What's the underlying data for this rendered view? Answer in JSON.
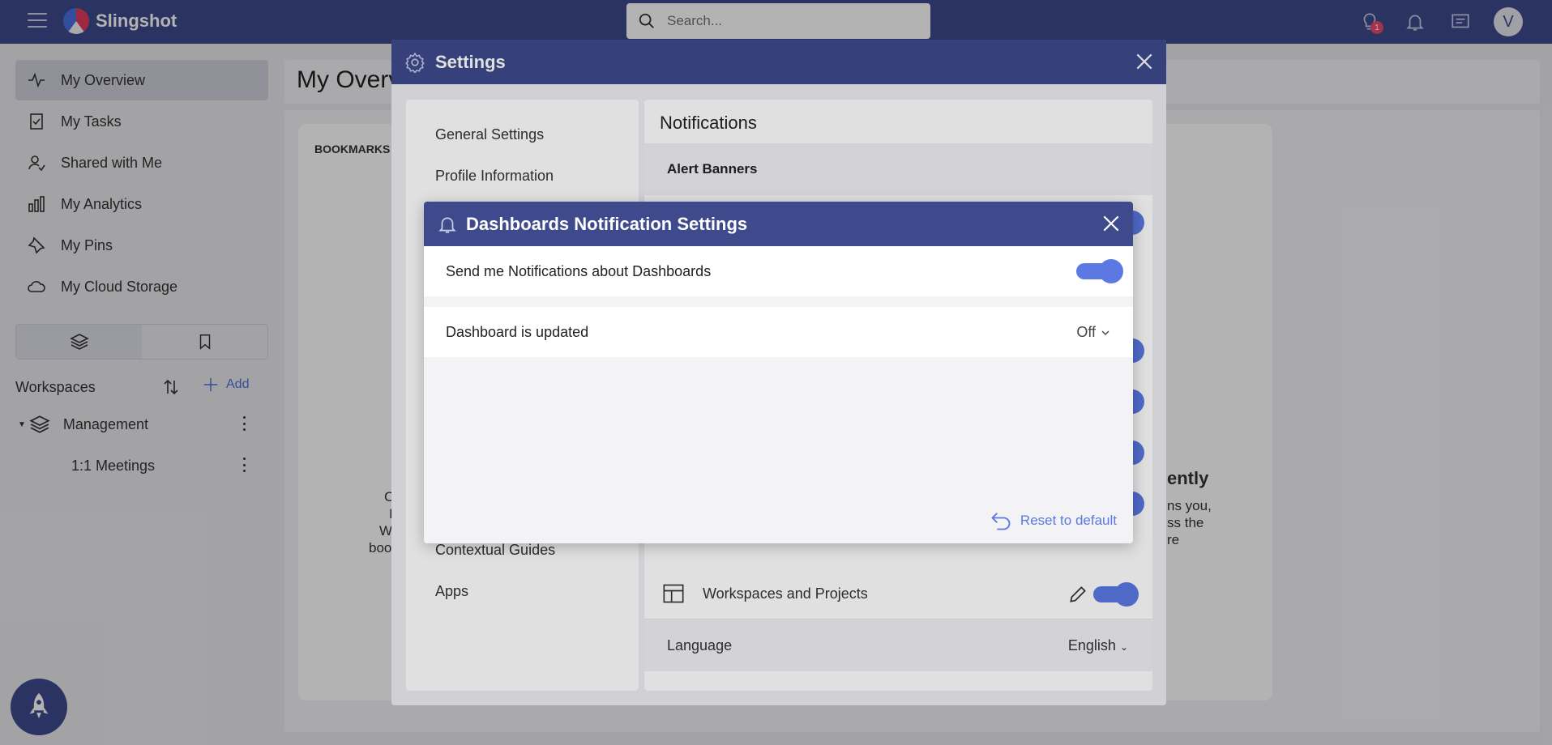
{
  "app": {
    "name": "Slingshot"
  },
  "search": {
    "placeholder": "Search..."
  },
  "topbar": {
    "notification_badge": "1",
    "avatar_initial": "V"
  },
  "sidebar": {
    "items": [
      {
        "label": "My Overview",
        "active": true
      },
      {
        "label": "My Tasks"
      },
      {
        "label": "Shared with Me"
      },
      {
        "label": "My Analytics"
      },
      {
        "label": "My Pins"
      },
      {
        "label": "My Cloud Storage"
      }
    ],
    "workspaces_label": "Workspaces",
    "add_label": "Add",
    "tree": [
      {
        "label": "Management"
      },
      {
        "label": "1:1 Meetings"
      }
    ]
  },
  "main": {
    "title": "My Overview",
    "bookmarks_title": "BOOKMARKS",
    "fragments_left": [
      "C",
      "I",
      "W",
      "boo"
    ],
    "fragments_right_title": "ently",
    "fragments_right": [
      "ns you,",
      "ss the",
      "re"
    ]
  },
  "settings": {
    "title": "Settings",
    "menu": [
      {
        "label": "General Settings"
      },
      {
        "label": "Profile Information"
      },
      {
        "label": "Contextual Guides"
      },
      {
        "label": "Apps"
      }
    ],
    "panel_title": "Notifications",
    "section": "Alert Banners",
    "workspaces_row": "Workspaces and Projects",
    "language_label": "Language",
    "language_value": "English"
  },
  "notification_dialog": {
    "title": "Dashboards Notification Settings",
    "row1_label": "Send me Notifications about Dashboards",
    "row1_enabled": true,
    "row2_label": "Dashboard is updated",
    "row2_value": "Off",
    "reset_label": "Reset to default"
  },
  "colors": {
    "brand": "#3e4a8c",
    "accent": "#5b78e3",
    "badge": "#e64a6f"
  }
}
